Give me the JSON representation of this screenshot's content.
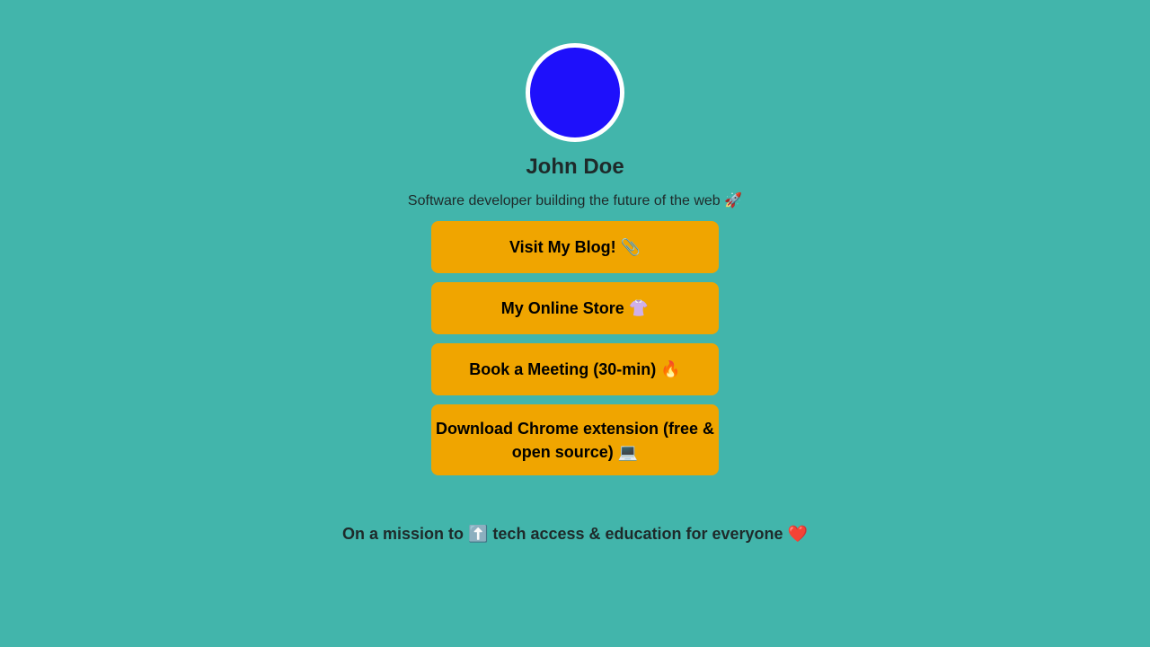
{
  "profile": {
    "avatar_color": "#1e10fb",
    "name": "John Doe",
    "bio": "Software developer building the future of the web 🚀"
  },
  "links": [
    {
      "label": "Visit My Blog! 📎"
    },
    {
      "label": "My Online Store 👚"
    },
    {
      "label": "Book a Meeting (30-min) 🔥"
    },
    {
      "label": "Download Chrome extension (free & open source) 💻"
    }
  ],
  "footer": {
    "tagline": "On a mission to ⬆️ tech access & education for everyone ❤️"
  },
  "colors": {
    "background": "#42b5ab",
    "button": "#f0a500",
    "text": "#1e2a2a"
  }
}
